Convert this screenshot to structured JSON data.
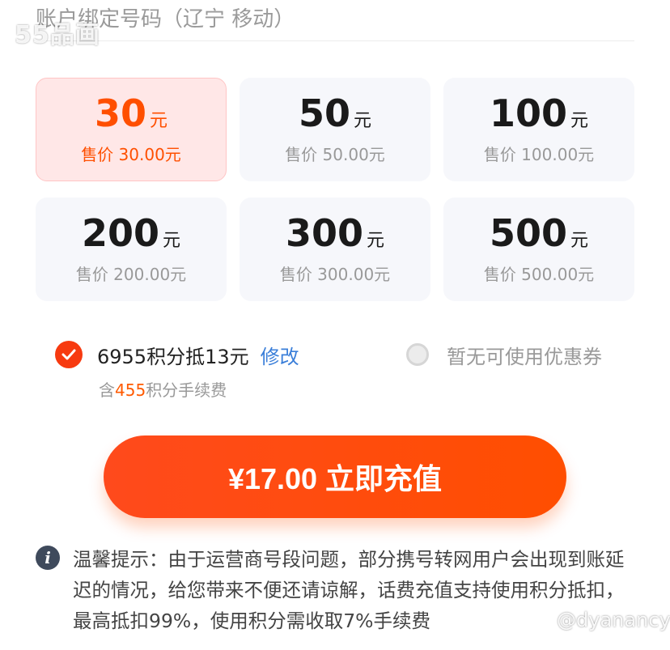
{
  "account": {
    "text": "账户绑定号码（辽宁 移动）"
  },
  "watermarks": {
    "logo": "55品画",
    "user": "@dyanancy"
  },
  "amount_unit": "元",
  "options": [
    {
      "amount": "30",
      "price": "售价 30.00元",
      "selected": true
    },
    {
      "amount": "50",
      "price": "售价 50.00元",
      "selected": false
    },
    {
      "amount": "100",
      "price": "售价 100.00元",
      "selected": false
    },
    {
      "amount": "200",
      "price": "售价 200.00元",
      "selected": false
    },
    {
      "amount": "300",
      "price": "售价 300.00元",
      "selected": false
    },
    {
      "amount": "500",
      "price": "售价 500.00元",
      "selected": false
    }
  ],
  "points": {
    "label": "6955积分抵13元",
    "modify_label": "修改",
    "fee_prefix": "含",
    "fee_value": "455",
    "fee_suffix": "积分手续费"
  },
  "coupon": {
    "label": "暂无可使用优惠券"
  },
  "pay_button": {
    "label": "¥17.00 立即充值"
  },
  "tip": {
    "icon_char": "i",
    "text": "温馨提示：由于运营商号段问题，部分携号转网用户会出现到账延迟的情况，给您带来不便还请谅解，话费充值支持使用积分抵扣，最高抵扣99%，使用积分需收取7%手续费"
  },
  "colors": {
    "accent": "#ff4f00",
    "selected_bg": "#ffe7e7",
    "card_bg": "#f6f7fb",
    "link": "#3b7fd9"
  }
}
